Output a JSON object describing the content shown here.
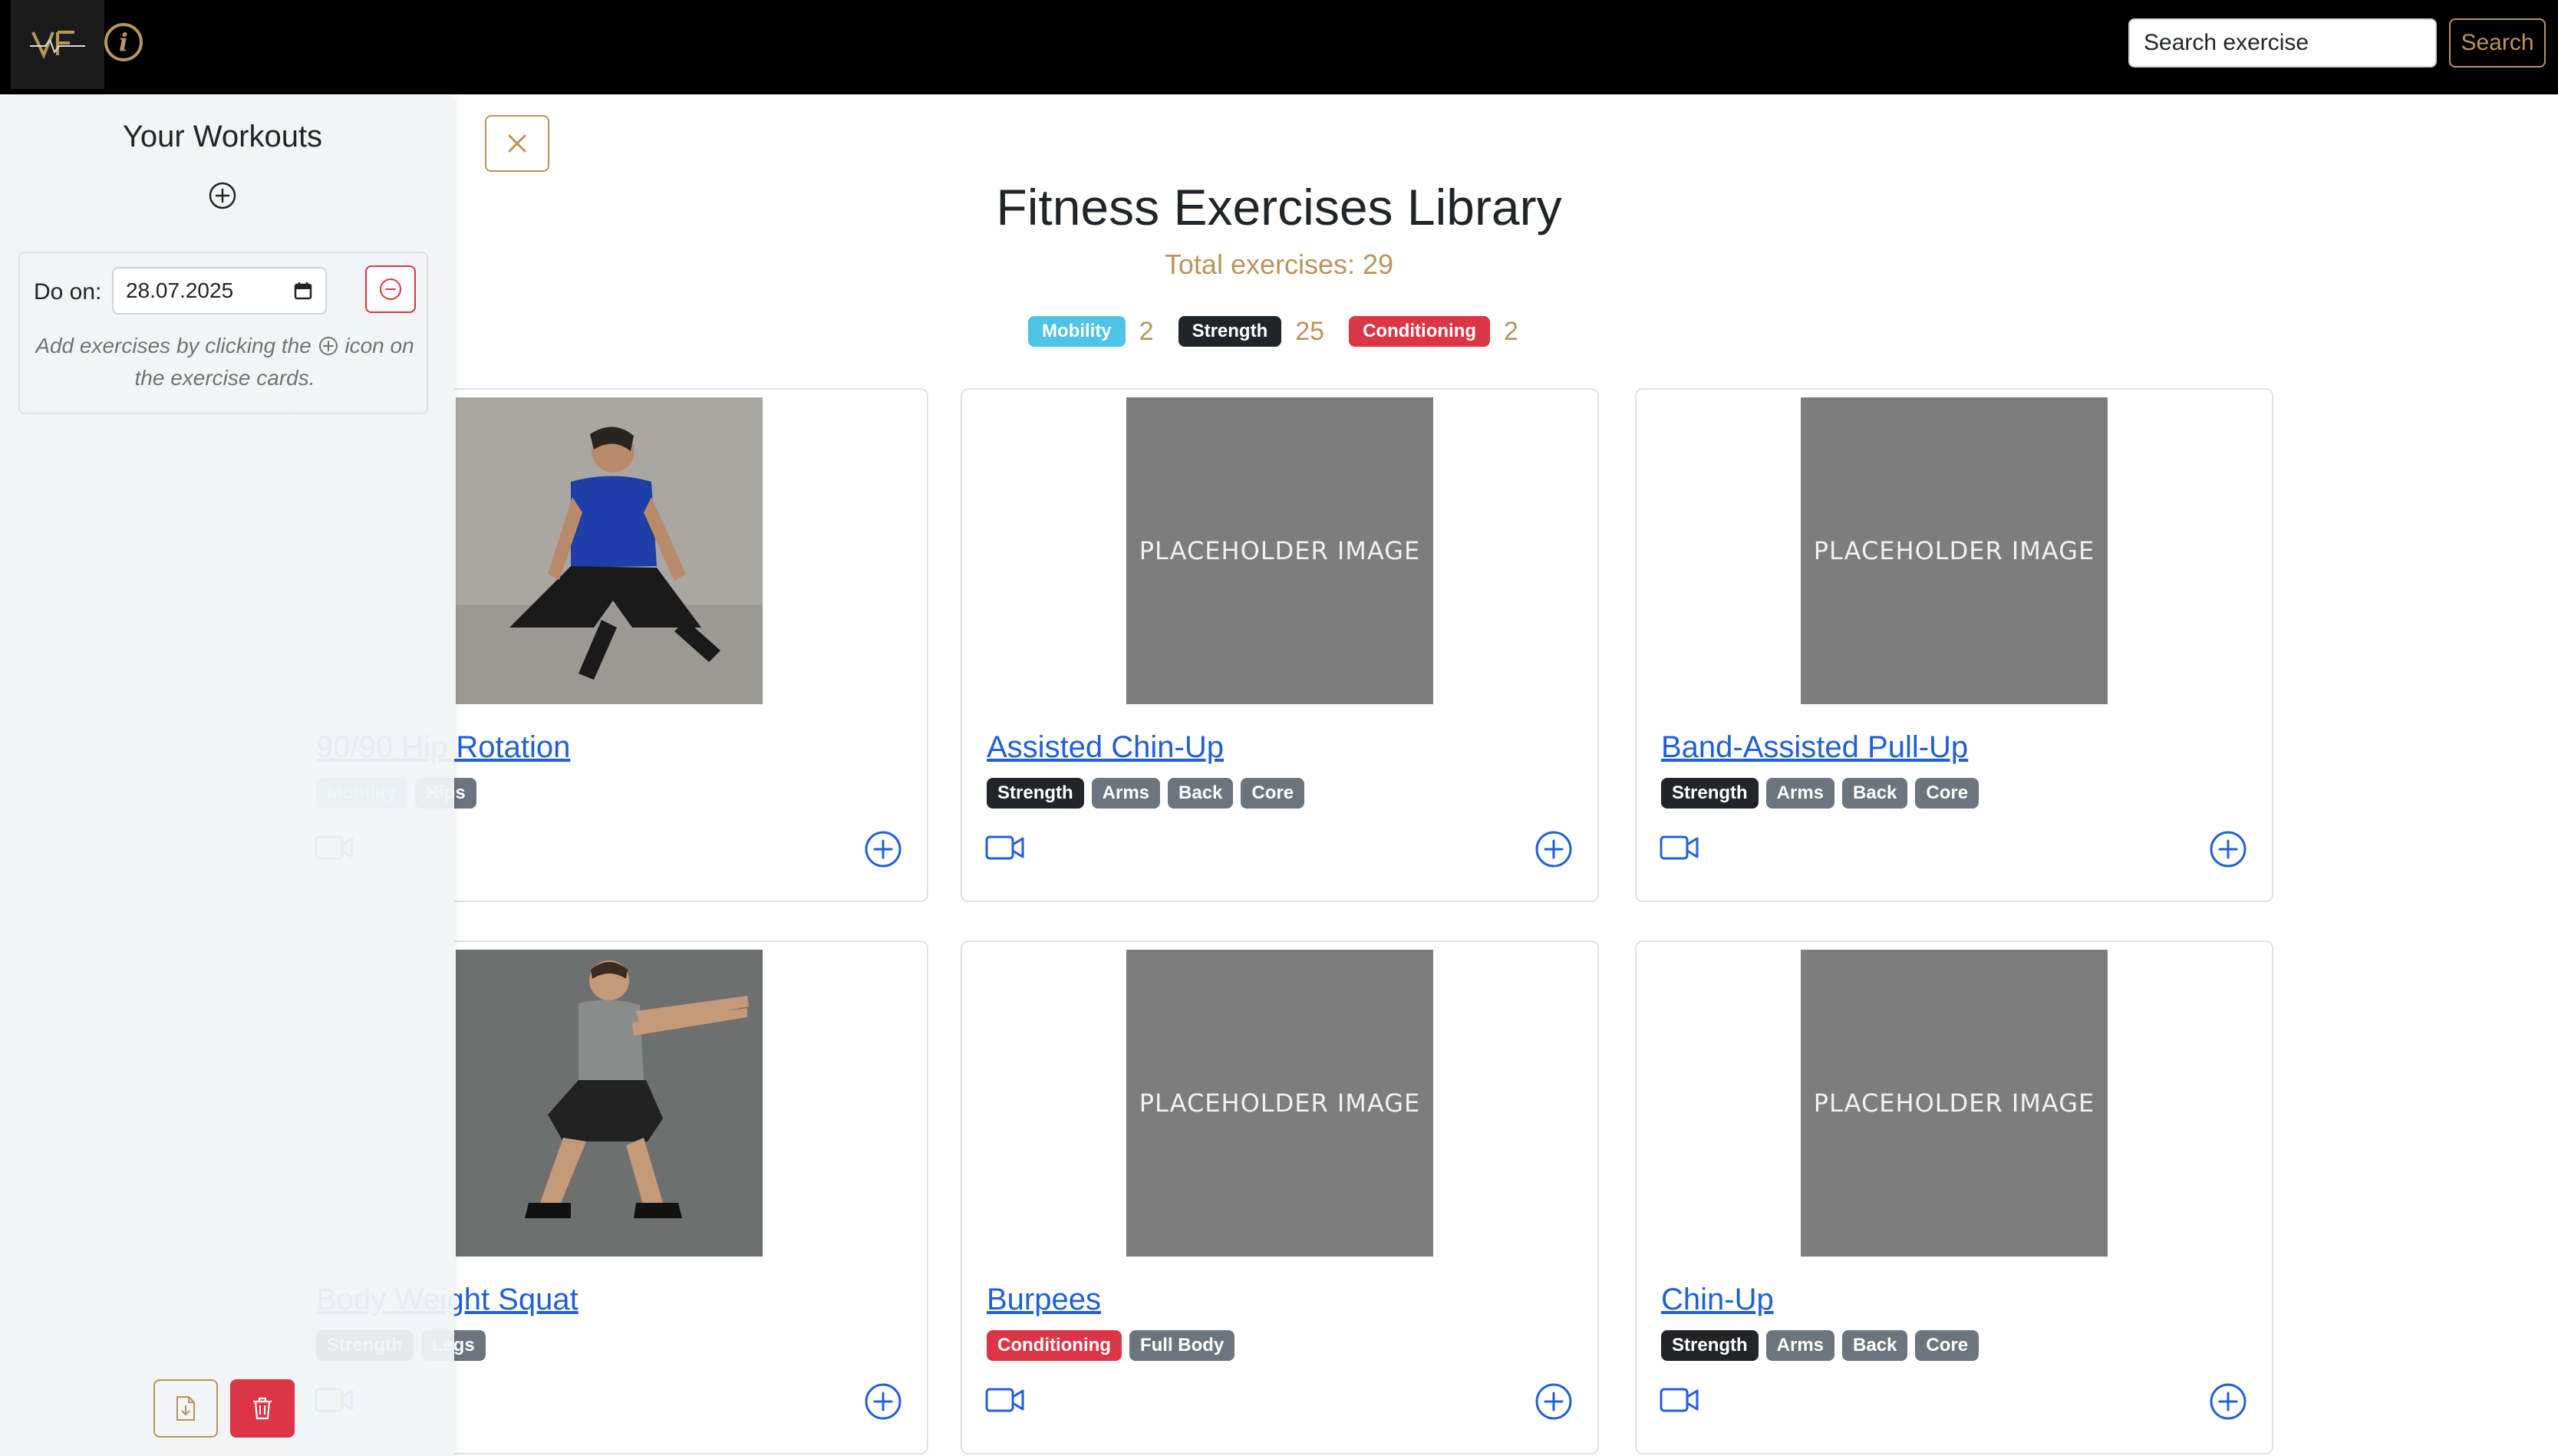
{
  "navbar": {
    "logo_text": "VF",
    "info_icon": "info-icon",
    "search_placeholder": "Search exercise",
    "search_button": "Search",
    "accent_color": "#b8955a"
  },
  "main": {
    "close_icon": "close-icon",
    "title": "Fitness Exercises Library",
    "total_label": "Total exercises:",
    "total_count": "29",
    "categories": [
      {
        "label": "Mobility",
        "count": "2",
        "color": "#4dc3e6"
      },
      {
        "label": "Strength",
        "count": "25",
        "color": "#212529"
      },
      {
        "label": "Conditioning",
        "count": "2",
        "color": "#dc3545"
      }
    ],
    "cards": [
      {
        "title": "90/90 Hip Rotation",
        "image": "photo",
        "tags": [
          {
            "label": "Mobility",
            "type": "Mobility"
          },
          {
            "label": "Hips",
            "type": "muscle"
          }
        ]
      },
      {
        "title": "Assisted Chin-Up",
        "image": "PLACEHOLDER IMAGE",
        "tags": [
          {
            "label": "Strength",
            "type": "Strength"
          },
          {
            "label": "Arms",
            "type": "muscle"
          },
          {
            "label": "Back",
            "type": "muscle"
          },
          {
            "label": "Core",
            "type": "muscle"
          }
        ]
      },
      {
        "title": "Band-Assisted Pull-Up",
        "image": "PLACEHOLDER IMAGE",
        "tags": [
          {
            "label": "Strength",
            "type": "Strength"
          },
          {
            "label": "Arms",
            "type": "muscle"
          },
          {
            "label": "Back",
            "type": "muscle"
          },
          {
            "label": "Core",
            "type": "muscle"
          }
        ]
      },
      {
        "title": "Body Weight Squat",
        "image": "photo",
        "tags": [
          {
            "label": "Strength",
            "type": "Strength"
          },
          {
            "label": "Legs",
            "type": "muscle"
          }
        ]
      },
      {
        "title": "Burpees",
        "image": "PLACEHOLDER IMAGE",
        "tags": [
          {
            "label": "Conditioning",
            "type": "Conditioning"
          },
          {
            "label": "Full Body",
            "type": "muscle"
          }
        ]
      },
      {
        "title": "Chin-Up",
        "image": "PLACEHOLDER IMAGE",
        "tags": [
          {
            "label": "Strength",
            "type": "Strength"
          },
          {
            "label": "Arms",
            "type": "muscle"
          },
          {
            "label": "Back",
            "type": "muscle"
          },
          {
            "label": "Core",
            "type": "muscle"
          }
        ]
      }
    ]
  },
  "sidebar": {
    "title": "Your Workouts",
    "add_icon": "add-circle-icon",
    "workout": {
      "do_on_label": "Do on:",
      "date_value": "28.07.2025",
      "hint_before": "Add exercises by clicking the",
      "hint_after": "icon on the exercise cards."
    },
    "export_icon": "file-export-icon",
    "delete_icon": "trash-icon"
  }
}
